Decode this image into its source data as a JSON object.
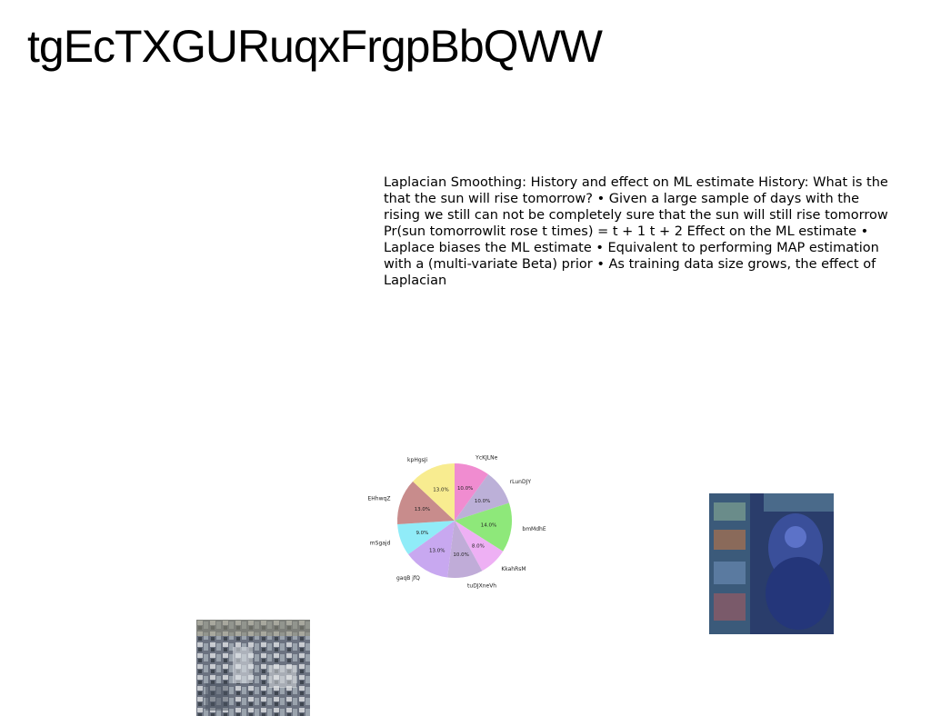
{
  "title": "tgEcTXGURuqxFrgpBbQWW",
  "body_text": "Laplacian Smoothing: History and effect on ML estimate History: What is the that the sun will rise tomorrow? • Given a large sample of days with the rising we still can not be completely sure that the sun will still rise tomorrow Pr(sun tomorrowlit rose t times) = t + 1 t + 2 Effect on the ML estimate • Laplace biases the ML estimate • Equivalent to performing MAP estimation with a (multi-variate Beta) prior • As training data size grows, the effect of Laplacian",
  "chart_data": {
    "type": "pie",
    "categories": [
      "YcKJLNe",
      "rLunDJY",
      "bmMdhE",
      "KkahRsM",
      "tuDJXneVh",
      "gaqB jfQ",
      "mSgajd",
      "EHhwqZ",
      "kpHgsJi"
    ],
    "values": [
      10.0,
      10.0,
      14.0,
      8.0,
      10.0,
      13.0,
      9.0,
      13.0,
      13.0
    ],
    "labels": [
      "10.0%",
      "10.0%",
      "14.0%",
      "8.0%",
      "10.0%",
      "13.0%",
      "9.0%",
      "13.0%",
      "13.0%"
    ],
    "colors": [
      "#f08cd0",
      "#bcb0d8",
      "#8ee87a",
      "#eeb0f4",
      "#c0acd8",
      "#c8a8f0",
      "#90ecf8",
      "#c88c8c",
      "#f8ec90"
    ]
  },
  "images": [
    {
      "name": "city-photo",
      "subject": "aerial city"
    },
    {
      "name": "temple-photo",
      "subject": "temple carvings"
    }
  ]
}
